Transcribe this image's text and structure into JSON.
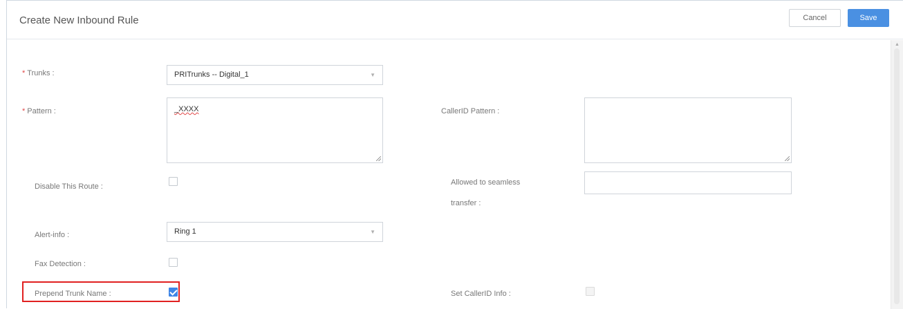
{
  "dialog": {
    "title": "Create New Inbound Rule",
    "cancel_label": "Cancel",
    "save_label": "Save"
  },
  "form": {
    "trunks": {
      "required_mark": "*",
      "label": "Trunks :",
      "value": "PRITrunks -- Digital_1"
    },
    "pattern": {
      "required_mark": "*",
      "label": "Pattern :",
      "value": "_XXXX"
    },
    "callerid_pattern": {
      "label": "CallerID Pattern :",
      "value": ""
    },
    "disable_route": {
      "label": "Disable This Route :",
      "checked": false
    },
    "allowed_seamless": {
      "label_line1": "Allowed to seamless",
      "label_line2": "transfer :",
      "value": ""
    },
    "alert_info": {
      "label": "Alert-info :",
      "value": "Ring 1"
    },
    "fax_detection": {
      "label": "Fax Detection :",
      "checked": false
    },
    "prepend_trunk_name": {
      "label": "Prepend Trunk Name :",
      "checked": true
    },
    "set_callerid_info": {
      "label": "Set CallerID Info :",
      "checked": false,
      "disabled": true
    }
  },
  "colors": {
    "accent": "#4a90e2",
    "required": "#e04747",
    "highlight_box": "#e02020"
  },
  "icons": {
    "select_caret": "chevron-down-icon",
    "scroll_up": "arrow-up-icon"
  }
}
